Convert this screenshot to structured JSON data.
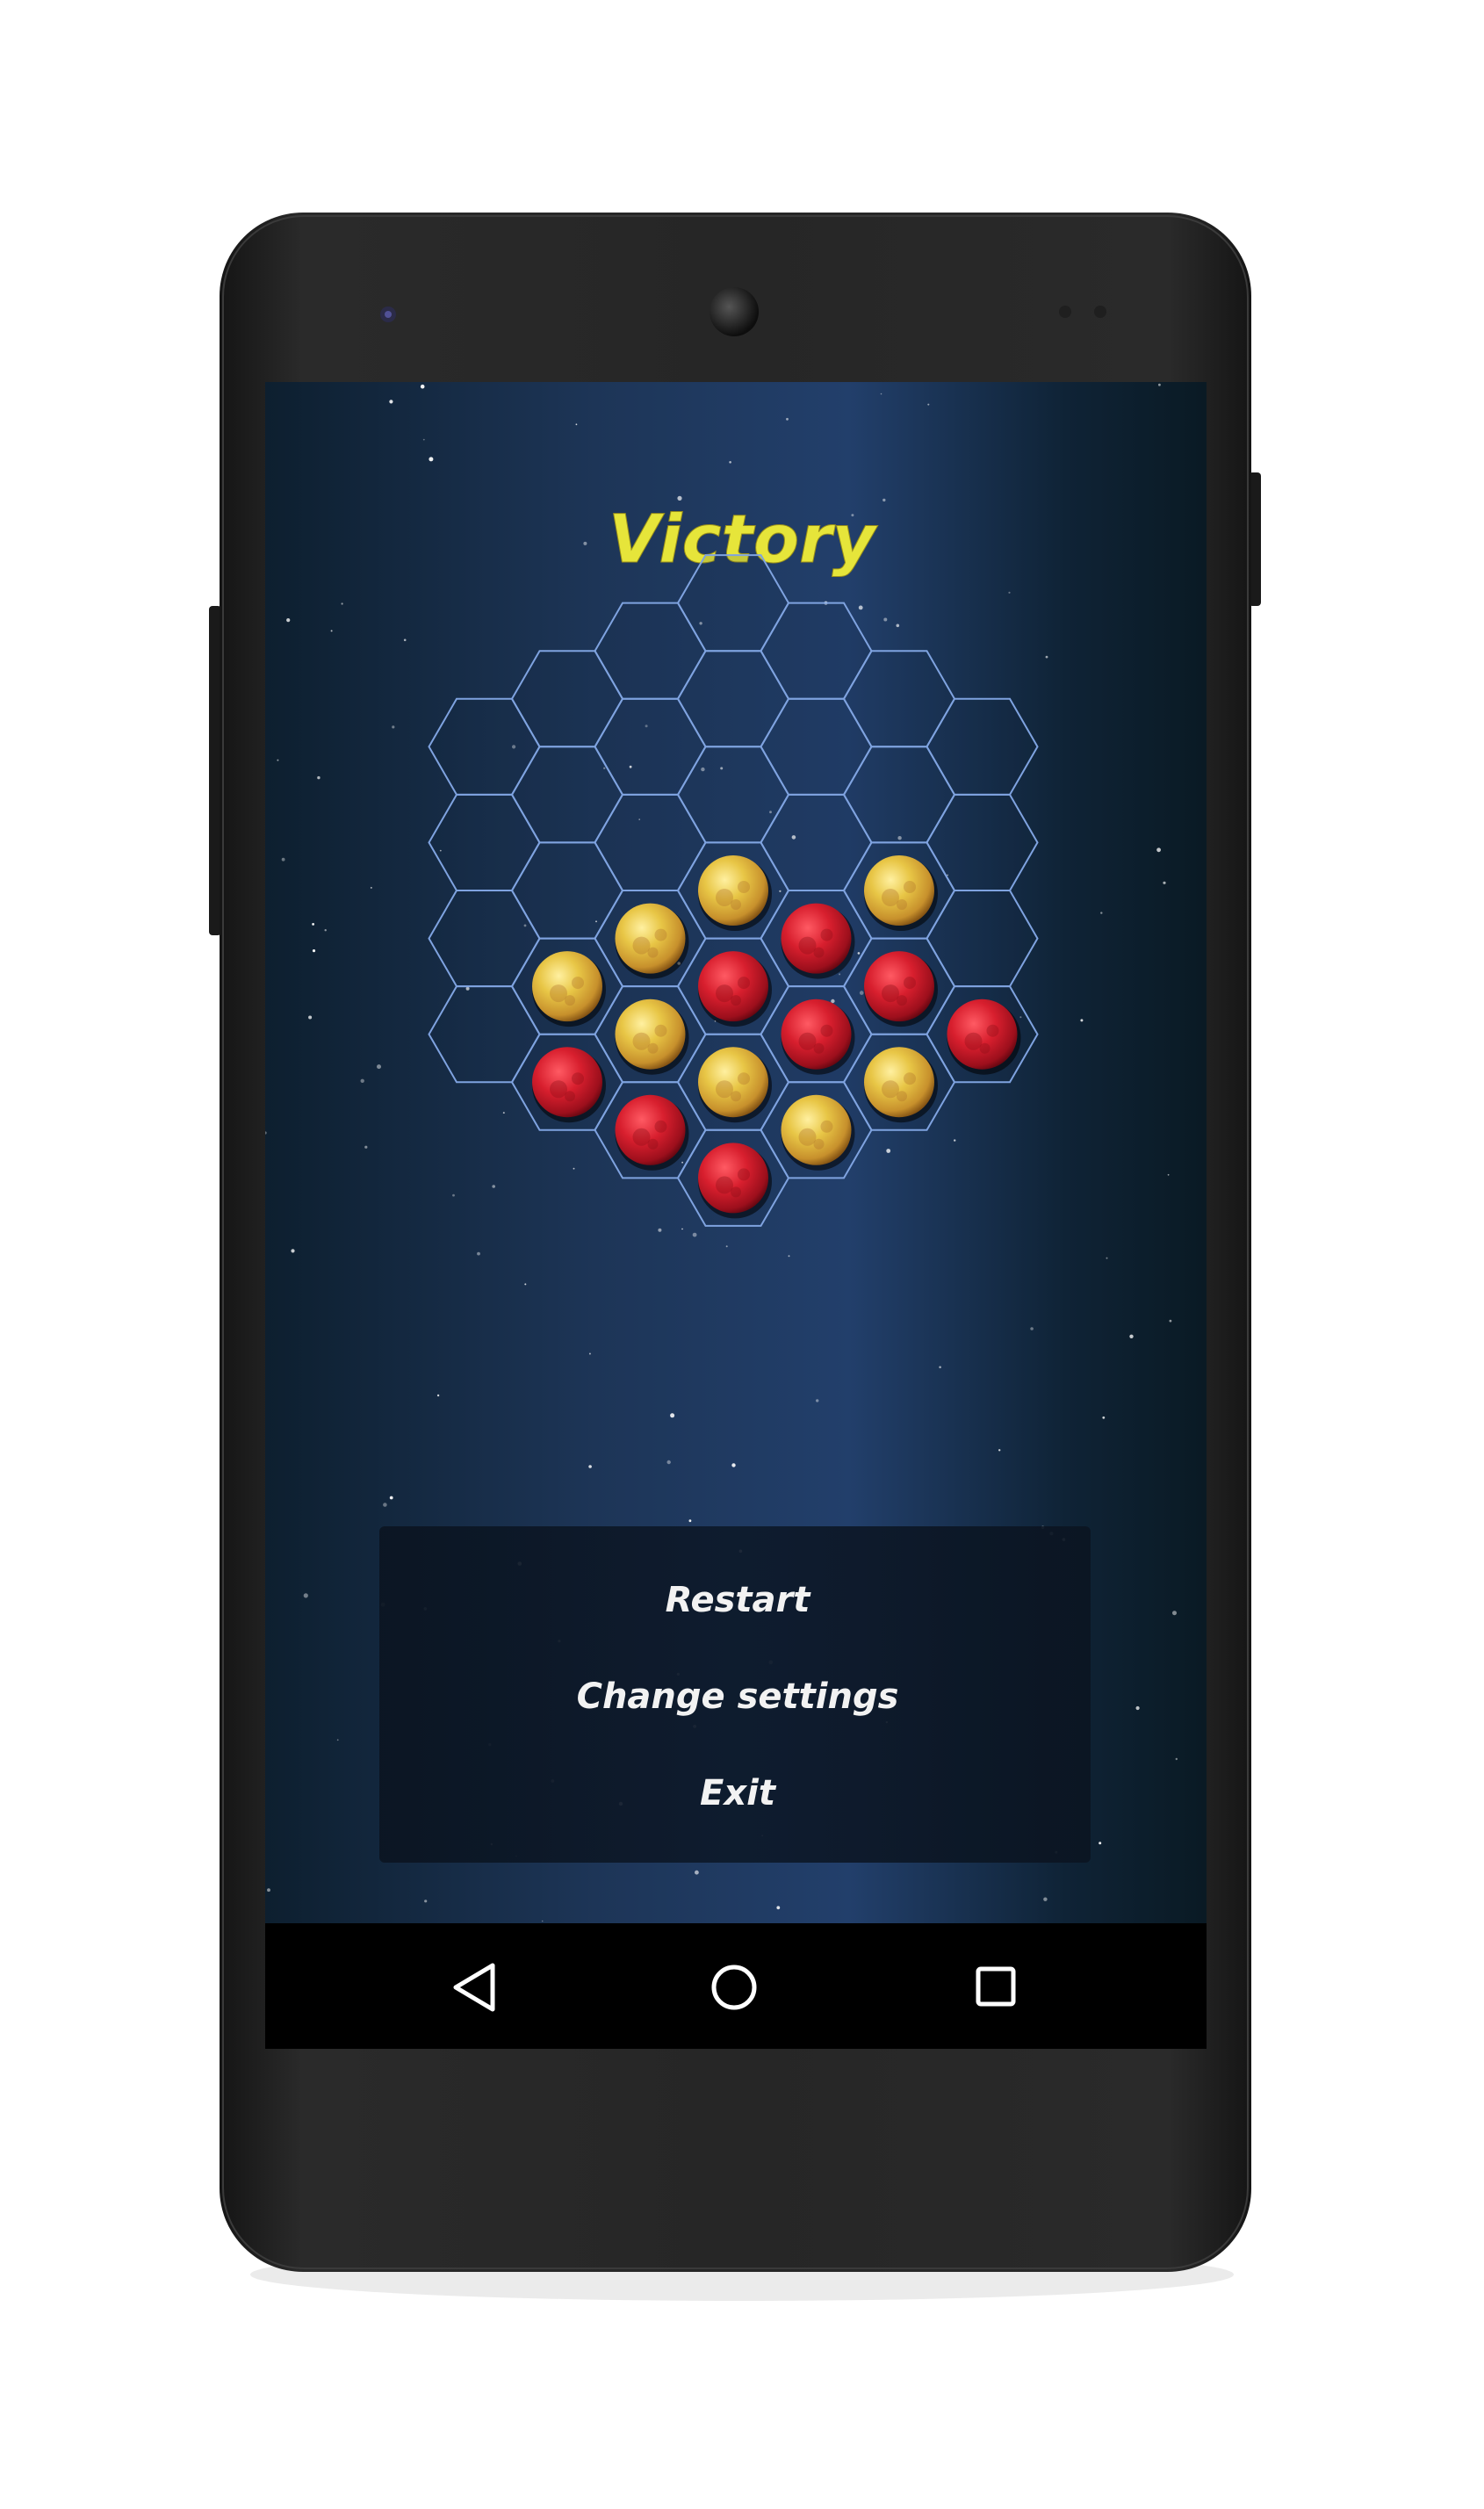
{
  "app": {
    "title": "Victory"
  },
  "menu": {
    "items": [
      {
        "id": "restart",
        "label": "Restart"
      },
      {
        "id": "change-settings",
        "label": "Change settings"
      },
      {
        "id": "exit",
        "label": "Exit"
      }
    ]
  },
  "board": {
    "radius": 3,
    "occupied": [
      {
        "q": -2,
        "r": 3,
        "color": "red"
      },
      {
        "q": -1,
        "r": 3,
        "color": "red"
      },
      {
        "q": 0,
        "r": 3,
        "color": "red"
      },
      {
        "q": -2,
        "r": 2,
        "color": "yellow"
      },
      {
        "q": -1,
        "r": 2,
        "color": "yellow"
      },
      {
        "q": 0,
        "r": 2,
        "color": "yellow"
      },
      {
        "q": 1,
        "r": 2,
        "color": "yellow"
      },
      {
        "q": 2,
        "r": 1,
        "color": "yellow"
      },
      {
        "q": -1,
        "r": 1,
        "color": "yellow"
      },
      {
        "q": 0,
        "r": 1,
        "color": "red"
      },
      {
        "q": 1,
        "r": 1,
        "color": "red"
      },
      {
        "q": 2,
        "r": 0,
        "color": "red"
      },
      {
        "q": 3,
        "r": 0,
        "color": "red"
      },
      {
        "q": 0,
        "r": 0,
        "color": "yellow"
      },
      {
        "q": 1,
        "r": 0,
        "color": "red"
      },
      {
        "q": 2,
        "r": -1,
        "color": "yellow"
      }
    ]
  },
  "nav_bar": {
    "icons": [
      "back-icon",
      "home-icon",
      "recents-icon"
    ]
  },
  "colors": {
    "title": "#e6e53a",
    "menu_text": "#f2f2f2",
    "hex_stroke": "#7fa3e0",
    "piece_red": "#d01e2c",
    "piece_yellow": "#e9c53e",
    "nav_bar": "#000000",
    "phone_body": "#222222"
  }
}
